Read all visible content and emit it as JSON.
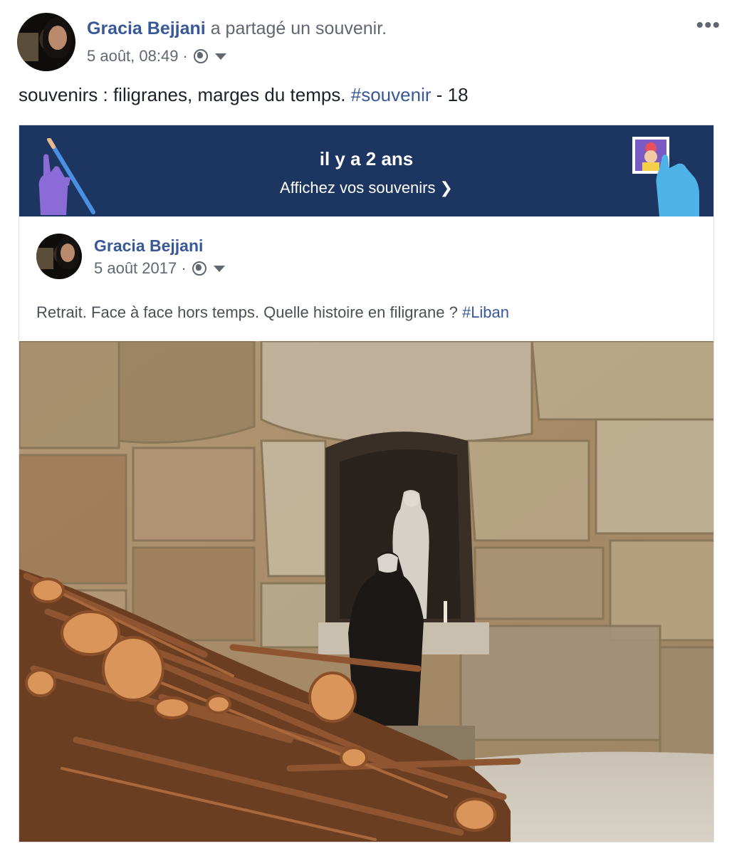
{
  "post": {
    "author": "Gracia Bejjani",
    "action": " a partagé un souvenir.",
    "timestamp": "5 août, 08:49 ·",
    "more": "•••",
    "text": "souvenirs : filigranes, marges du temps. ",
    "hashtag": "#souvenir",
    "text_suffix": " - 18"
  },
  "memory": {
    "title": "il y a 2 ans",
    "link": "Affichez vos souvenirs",
    "link_chevron": "❯"
  },
  "original_post": {
    "author": "Gracia Bejjani",
    "timestamp": "5 août 2017 ·",
    "text": "Retrait. Face à face hors temps. Quelle histoire en filigrane ? ",
    "hashtag": "#Liban"
  },
  "icons": [
    "globe-icon",
    "chevron-down-icon",
    "more-options-icon",
    "chevron-right-icon"
  ],
  "colors": {
    "link_blue": "#385898",
    "banner_navy": "#1c3661",
    "secondary_text": "#606770"
  }
}
